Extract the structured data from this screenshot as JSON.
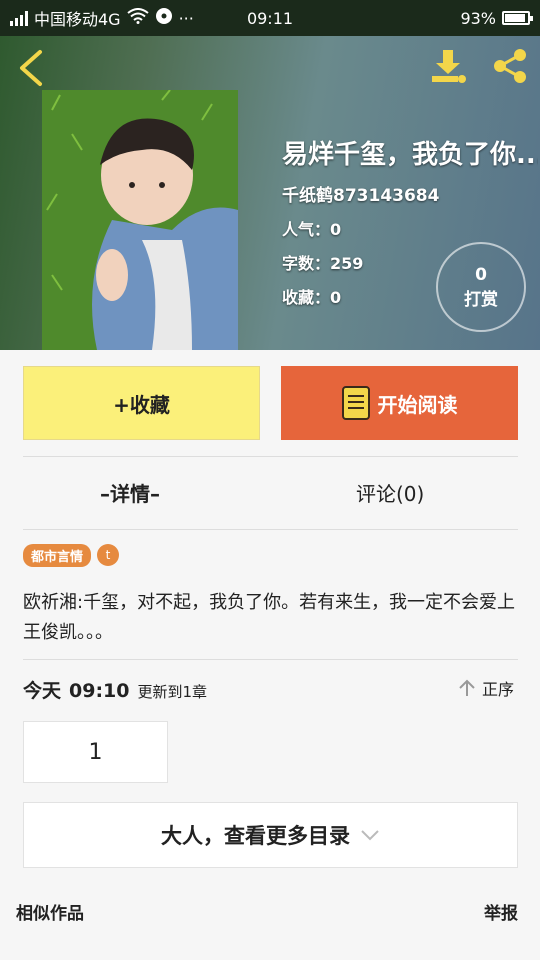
{
  "status_bar": {
    "carrier": "中国移动4G",
    "extra": "···",
    "time": "09:11",
    "battery_text": "93%",
    "battery_level": 0.93
  },
  "header": {
    "title": "易烊千玺，我负了你...",
    "author": "千纸鹤873143684",
    "popularity": "人气：0",
    "word_count": "字数：259",
    "favorites": "收藏：0",
    "reward_count": "0",
    "reward_label": "打赏"
  },
  "actions": {
    "favorite_label": "+收藏",
    "read_label": "开始阅读"
  },
  "tabs": {
    "detail": "–详情–",
    "comments": "评论(0)"
  },
  "tags": {
    "genre": "都市言情",
    "badge": "t"
  },
  "description": "欧祈湘:千玺，对不起，我负了你。若有来生，我一定不会爱上王俊凯。。。",
  "update": {
    "today": "今天",
    "time": "09:10",
    "chapter_text": "更新到1章",
    "order_label": "正序"
  },
  "chapters": [
    "1"
  ],
  "more_label": "大人，查看更多目录",
  "footer": {
    "similar": "相似作品",
    "report": "举报"
  },
  "colors": {
    "accent_orange": "#e6653b",
    "fav_yellow": "#fbf07a",
    "tag_orange": "#e68a3f",
    "icon_yellow": "#f3d64a"
  }
}
